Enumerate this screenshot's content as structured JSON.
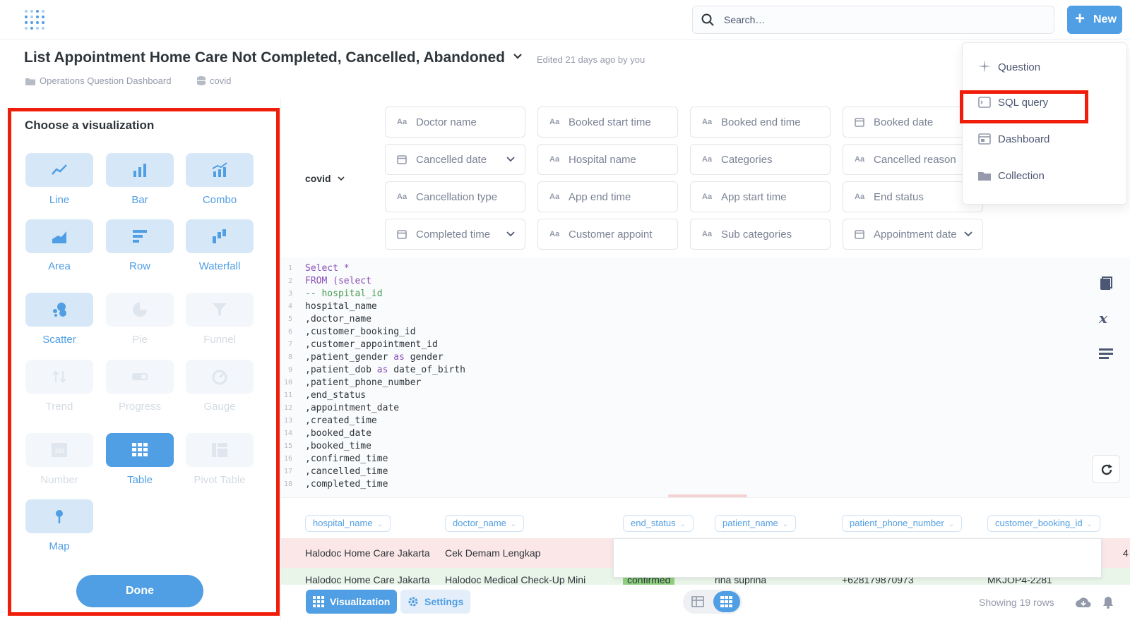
{
  "topbar": {
    "search_placeholder": "Search…",
    "new_label": "New"
  },
  "header": {
    "title": "List Appointment Home Care Not Completed, Cancelled, Abandoned",
    "edited": "Edited 21 days ago by you",
    "collection": "Operations Question Dashboard",
    "database": "covid"
  },
  "viz_panel": {
    "title": "Choose a visualization",
    "items": [
      "Line",
      "Bar",
      "Combo",
      "Area",
      "Row",
      "Waterfall",
      "Scatter",
      "Pie",
      "Funnel",
      "Trend",
      "Progress",
      "Gauge",
      "Number",
      "Table",
      "Pivot Table",
      "Map"
    ],
    "selected": "Table",
    "disabled": [
      "Pie",
      "Funnel",
      "Trend",
      "Progress",
      "Gauge",
      "Number",
      "Pivot Table"
    ],
    "done_label": "Done",
    "number_icon_text": "100"
  },
  "filters": {
    "database": "covid",
    "chips": [
      "Doctor name",
      "Booked start time",
      "Booked end time",
      "Booked date",
      "Cancelled date",
      "Hospital name",
      "Categories",
      "Cancelled reason",
      "Cancellation type",
      "App end time",
      "App start time",
      "End status",
      "Completed time",
      "Customer appoint",
      "Sub categories",
      "Appointment date"
    ]
  },
  "editor": {
    "lines": [
      {
        "n": "1",
        "t": "Select *"
      },
      {
        "n": "2",
        "t": "FROM (select"
      },
      {
        "n": "3",
        "t": "-- hospital_id"
      },
      {
        "n": "4",
        "t": "hospital_name"
      },
      {
        "n": "5",
        "t": ",doctor_name"
      },
      {
        "n": "6",
        "t": ",customer_booking_id"
      },
      {
        "n": "7",
        "t": ",customer_appointment_id"
      },
      {
        "n": "8",
        "t": ",patient_gender as gender"
      },
      {
        "n": "9",
        "t": ",patient_dob as date_of_birth"
      },
      {
        "n": "10",
        "t": ",patient_phone_number"
      },
      {
        "n": "11",
        "t": ",end_status"
      },
      {
        "n": "12",
        "t": ",appointment_date"
      },
      {
        "n": "13",
        "t": ",created_time"
      },
      {
        "n": "14",
        "t": ",booked_date"
      },
      {
        "n": "15",
        "t": ",booked_time"
      },
      {
        "n": "16",
        "t": ",confirmed_time"
      },
      {
        "n": "17",
        "t": ",cancelled_time"
      },
      {
        "n": "18",
        "t": ",completed_time"
      }
    ]
  },
  "results": {
    "columns": [
      "hospital_name",
      "doctor_name",
      "end_status",
      "patient_name",
      "patient_phone_number",
      "customer_booking_id"
    ],
    "rows": [
      [
        "Halodoc Home Care Jakarta",
        "Cek Demam Lengkap"
      ],
      [
        "Halodoc Home Care Jakarta",
        "Halodoc Medical Check-Up Mini",
        "confirmed",
        "rina suprina",
        "+628179870973",
        "MKJOP4-2281"
      ]
    ],
    "row1_tail": "4"
  },
  "footer": {
    "visualization_label": "Visualization",
    "settings_label": "Settings",
    "showing": "Showing 19 rows"
  },
  "new_menu": {
    "items": [
      "Question",
      "SQL query",
      "Dashboard",
      "Collection"
    ],
    "highlighted": "SQL query"
  },
  "colors": {
    "accent": "#509ee3",
    "highlight_red": "#f01d0b"
  }
}
